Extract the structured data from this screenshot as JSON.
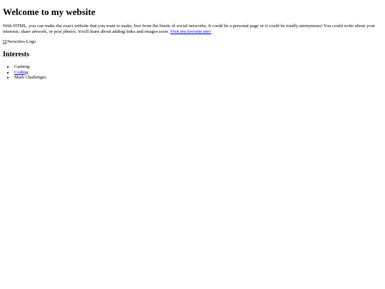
{
  "page": {
    "heading": "Welcome to my website",
    "intro_text": "With HTML, you can make the exact website that you want to make, free from the limits of social networks. It could be a personal page or it could be totally anonymous! You could write about your interests, share artwork, or post photos. You'll learn about adding links and images soon. ",
    "favorite_link": "Visit my favorite site!",
    "logo_alt": "Neocities Logo",
    "interests_heading": "Interests",
    "interests": [
      {
        "label": "Gaming",
        "is_link": false
      },
      {
        "label": "Coding",
        "is_link": true
      },
      {
        "label": "Math Challenges",
        "is_link": false
      }
    ]
  },
  "colors": {
    "link": "#0000ee",
    "text": "#000000",
    "background": "#ffffff"
  },
  "icons": {
    "logo": "broken-image-icon"
  }
}
